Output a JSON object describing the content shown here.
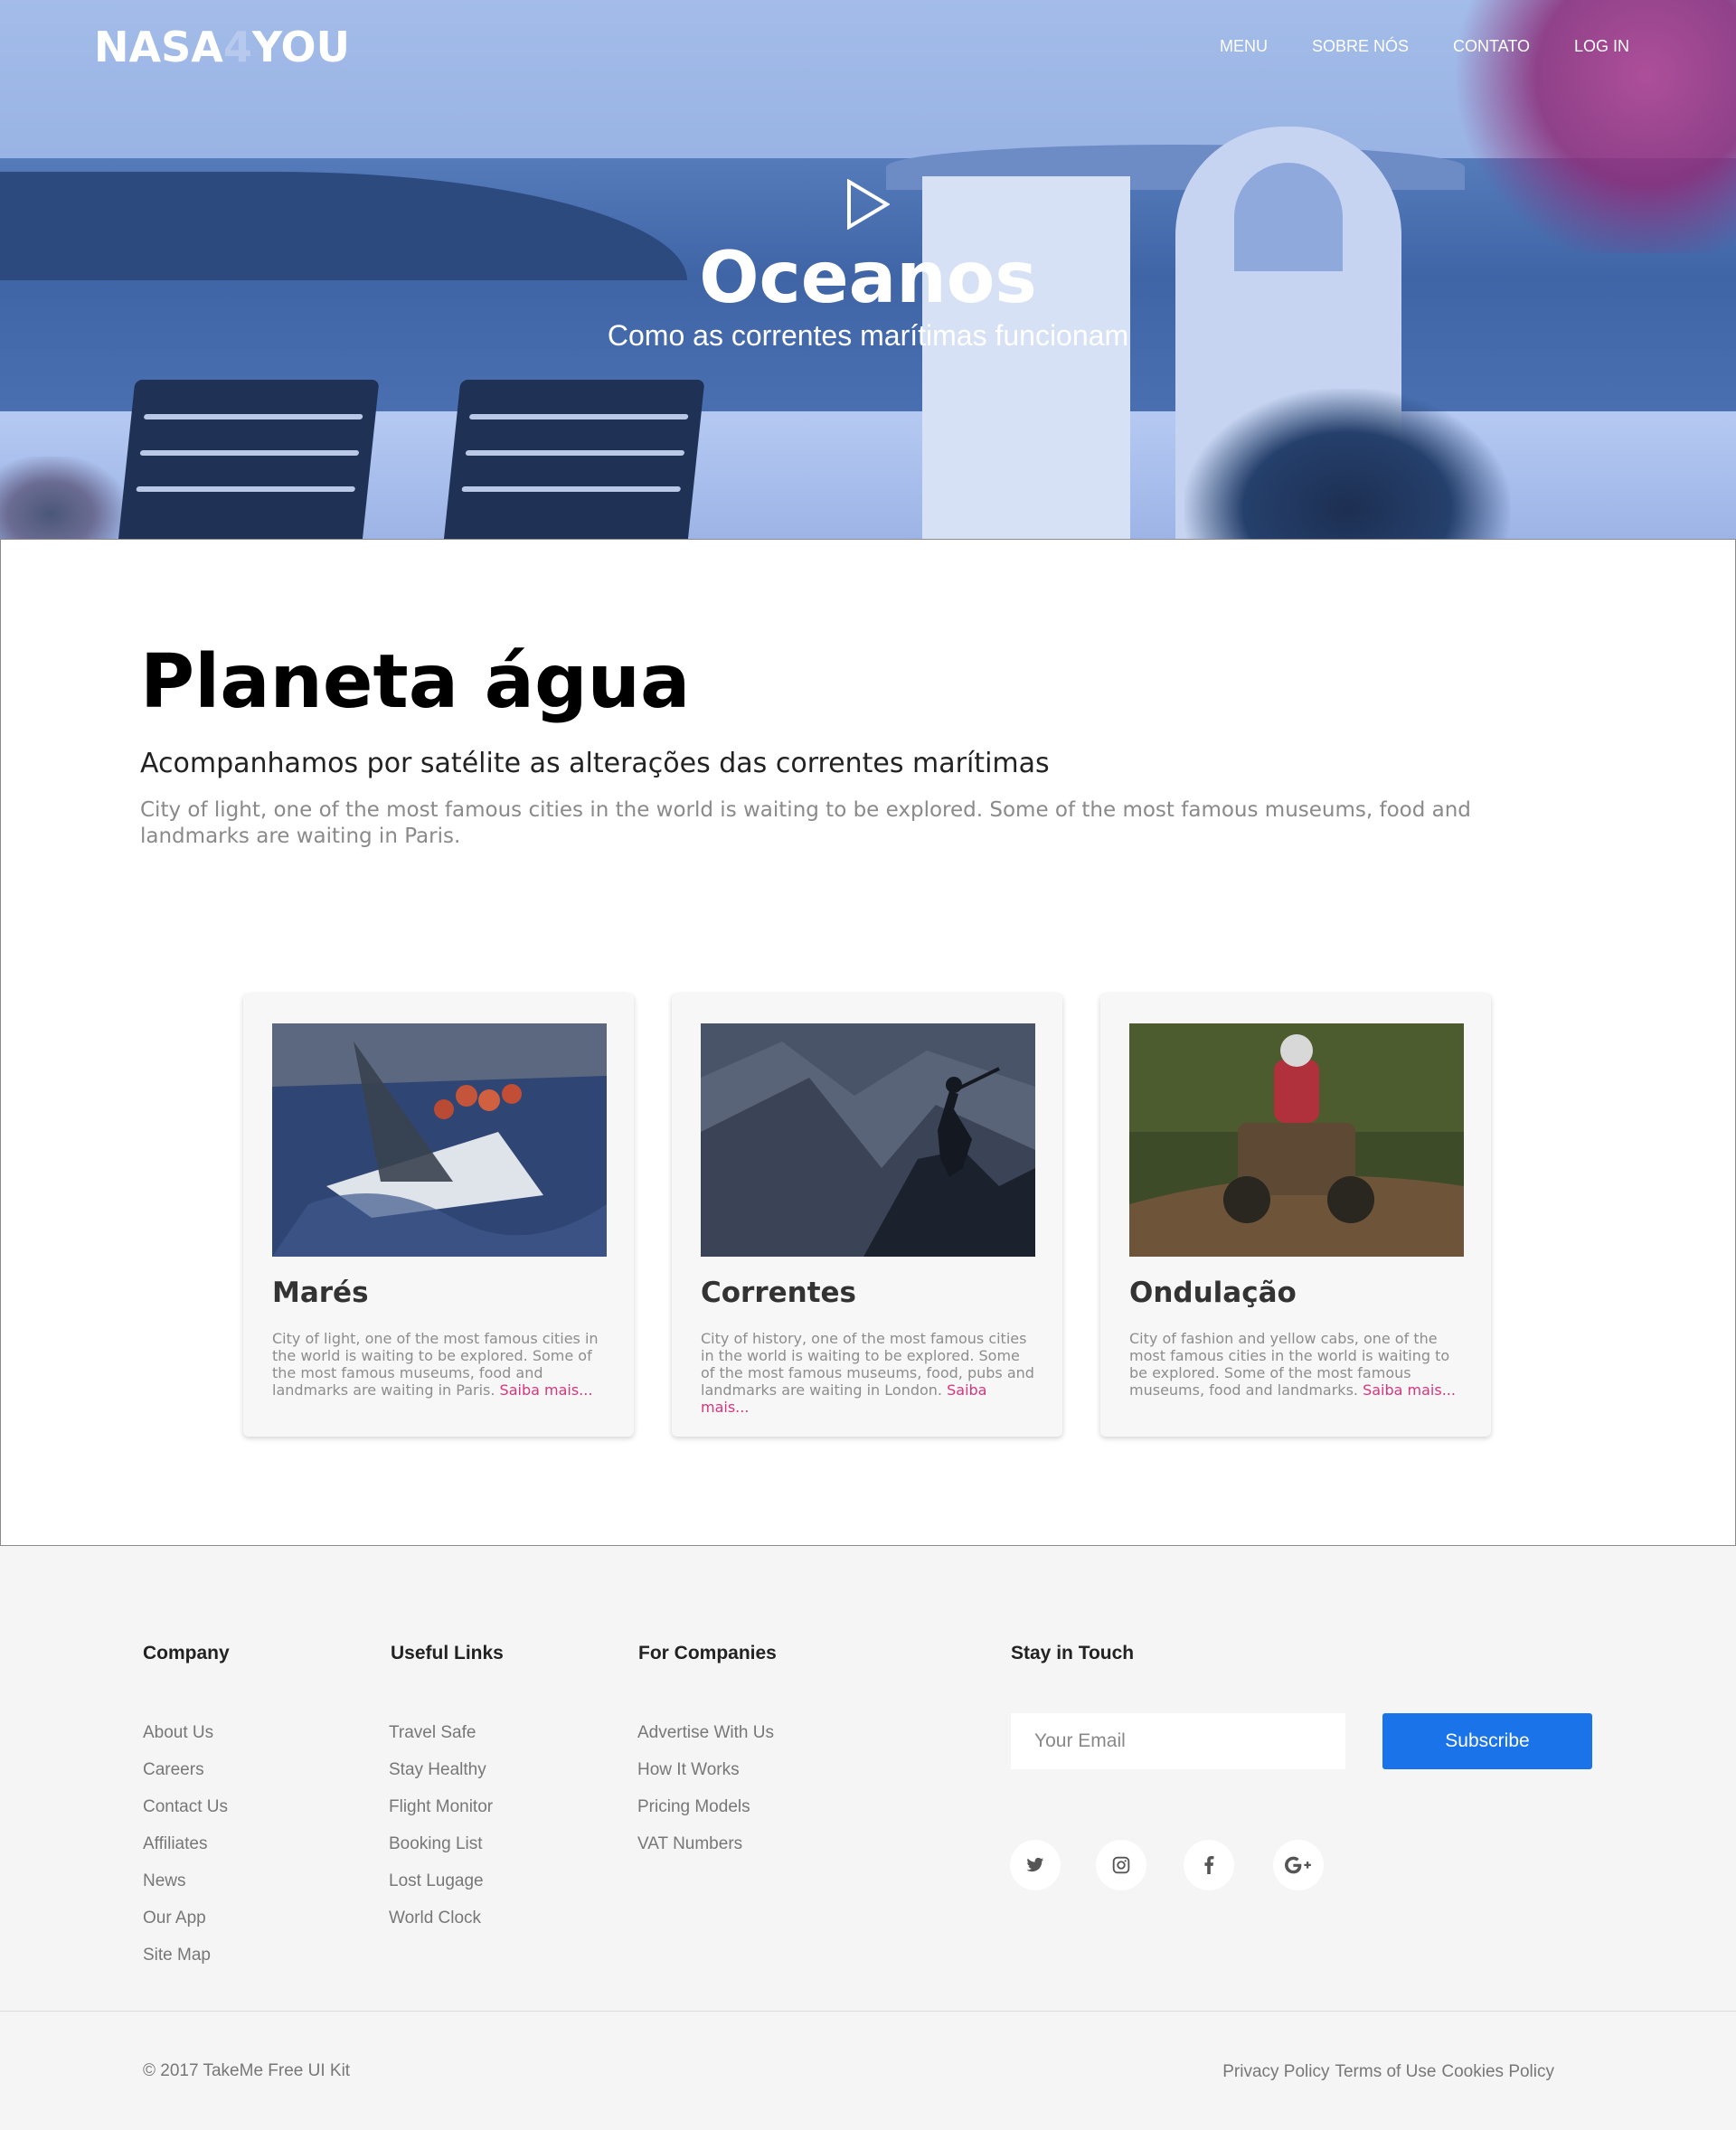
{
  "header": {
    "logo_text": "NASA",
    "logo_accent": "4",
    "logo_tail": "YOU",
    "nav": [
      "MENU",
      "SOBRE NÓS",
      "CONTATO",
      "LOG IN"
    ]
  },
  "hero": {
    "title": "Oceanos",
    "subtitle": "Como as correntes marítimas funcionam",
    "play_icon": "play-icon"
  },
  "main": {
    "title": "Planeta água",
    "subtitle": "Acompanhamos por satélite as alterações das correntes marítimas",
    "description": "City of light, one of the most famous cities in the world is waiting to be explored. Some of the most famous museums, food and landmarks are waiting in Paris.",
    "cards": [
      {
        "title": "Marés",
        "text": "City of light, one of the most famous cities in the world is waiting to be explored. Some of the most famous museums, food and landmarks are waiting in Paris.",
        "more": "Saiba mais..."
      },
      {
        "title": "Correntes",
        "text": "City of history, one of the most famous cities in the world is waiting to be explored. Some of the most famous museums, food, pubs and landmarks are waiting in London.",
        "more": "Saiba mais..."
      },
      {
        "title": "Ondulação",
        "text": "City of fashion and yellow cabs, one of the most famous cities in the world is waiting to be explored. Some of the most famous museums, food and landmarks.",
        "more": "Saiba mais..."
      }
    ]
  },
  "footer": {
    "columns": [
      {
        "title": "Company",
        "links": [
          "About Us",
          "Careers",
          "Contact Us",
          "Affiliates",
          "News",
          "Our App",
          "Site Map"
        ]
      },
      {
        "title": "Useful Links",
        "links": [
          "Travel Safe",
          "Stay Healthy",
          "Flight Monitor",
          "Booking List",
          "Lost Lugage",
          "World Clock"
        ]
      },
      {
        "title": "For Companies",
        "links": [
          "Advertise With Us",
          "How It Works",
          "Pricing Models",
          "VAT Numbers"
        ]
      }
    ],
    "stay_in_touch": "Stay in Touch",
    "email_placeholder": "Your Email",
    "subscribe_label": "Subscribe",
    "social_icons": [
      "twitter-icon",
      "instagram-icon",
      "facebook-icon",
      "google-plus-icon"
    ],
    "copyright": "© 2017 TakeMe Free UI Kit",
    "legal": [
      "Privacy Policy",
      "Terms of Use",
      "Cookies Policy"
    ]
  },
  "colors": {
    "accent": "#1a73e8",
    "link_pink": "#d6367b",
    "hero_overlay": "#8fa9dd"
  }
}
